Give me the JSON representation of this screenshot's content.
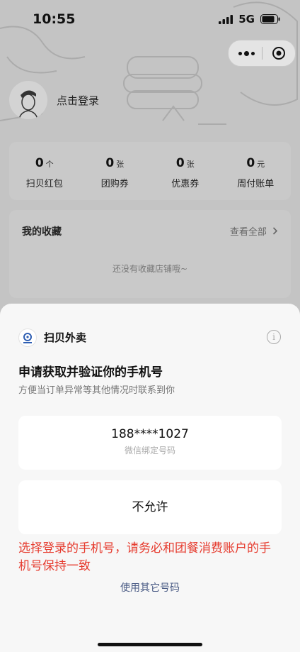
{
  "status_bar": {
    "time": "10:55",
    "network": "5G"
  },
  "profile": {
    "login_label": "点击登录"
  },
  "stats": [
    {
      "value": "0",
      "unit": "个",
      "label": "扫贝红包"
    },
    {
      "value": "0",
      "unit": "张",
      "label": "团购券"
    },
    {
      "value": "0",
      "unit": "张",
      "label": "优惠券"
    },
    {
      "value": "0",
      "unit": "元",
      "label": "周付账单"
    }
  ],
  "favorites": {
    "title": "我的收藏",
    "view_all": "查看全部",
    "empty": "还没有收藏店铺哦~"
  },
  "sheet": {
    "app_name": "扫贝外卖",
    "title": "申请获取并验证你的手机号",
    "subtitle": "方便当订单异常等其他情况时联系到你",
    "phone_number": "188****1027",
    "phone_hint": "微信绑定号码",
    "deny_label": "不允许",
    "warning": "选择登录的手机号，请务必和团餐消费账户的手机号保持一致",
    "other_number_link": "使用其它号码"
  },
  "colors": {
    "warning": "#e63b2e",
    "link": "#4a5b85",
    "overlay": "#c4c4c4"
  }
}
